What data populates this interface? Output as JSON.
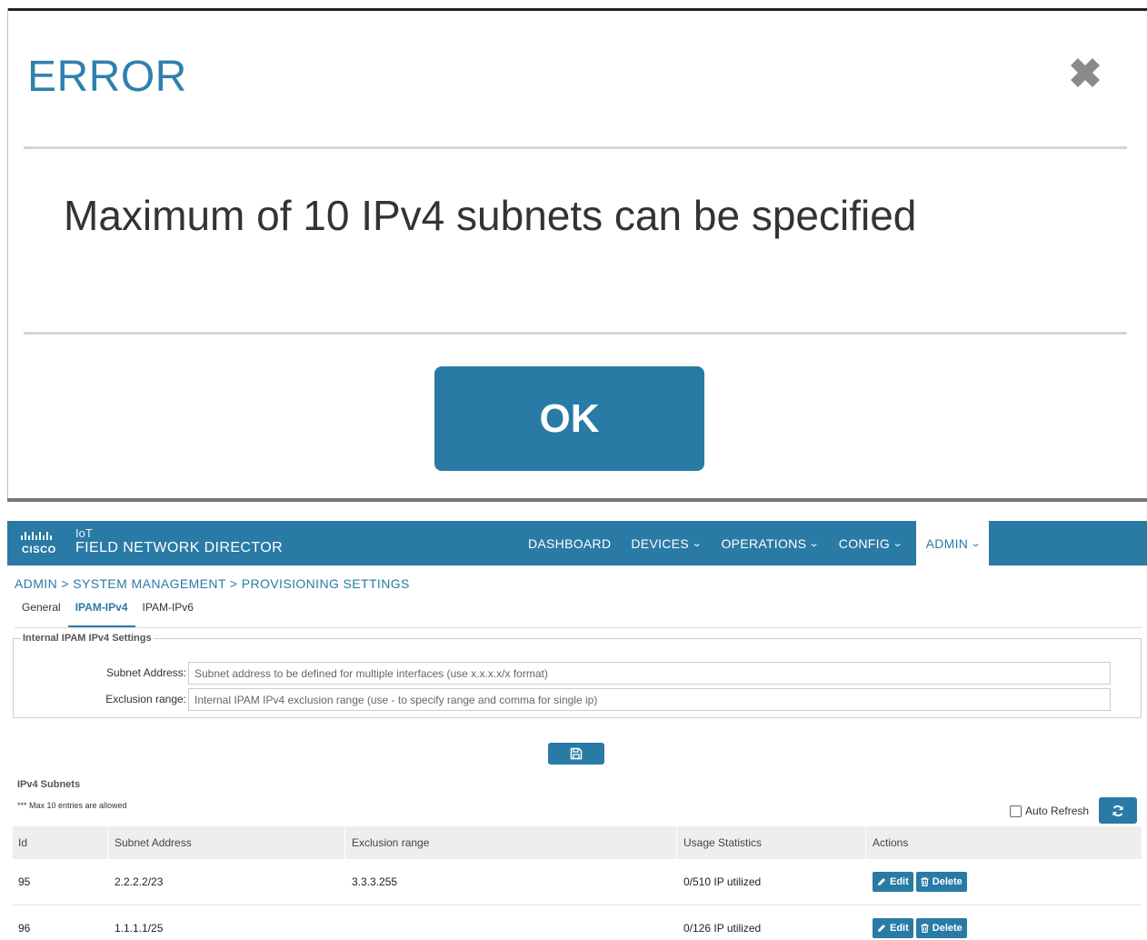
{
  "dialog": {
    "title": "ERROR",
    "message": "Maximum of 10 IPv4 subnets can be specified",
    "ok_label": "OK"
  },
  "header": {
    "brand_word": "CISCO",
    "product_line1": "IoT",
    "product_line2": "FIELD NETWORK DIRECTOR",
    "nav": [
      {
        "label": "DASHBOARD",
        "has_dropdown": false
      },
      {
        "label": "DEVICES",
        "has_dropdown": true
      },
      {
        "label": "OPERATIONS",
        "has_dropdown": true
      },
      {
        "label": "CONFIG",
        "has_dropdown": true
      },
      {
        "label": "ADMIN",
        "has_dropdown": true,
        "active": true
      }
    ]
  },
  "breadcrumb": "ADMIN > SYSTEM MANAGEMENT > PROVISIONING SETTINGS",
  "tabs": [
    {
      "label": "General"
    },
    {
      "label": "IPAM-IPv4",
      "active": true
    },
    {
      "label": "IPAM-IPv6"
    }
  ],
  "settings": {
    "legend": "Internal IPAM IPv4 Settings",
    "subnet_label": "Subnet Address:",
    "subnet_placeholder": "Subnet address to be defined for multiple interfaces (use x.x.x.x/x format)",
    "exclusion_label": "Exclusion range:",
    "exclusion_placeholder": "Internal IPAM IPv4 exclusion range (use - to specify range and comma for single ip)",
    "save_icon": "floppy-disk-icon"
  },
  "subnets": {
    "title": "IPv4 Subnets",
    "note": "*** Max 10 entries are allowed",
    "auto_refresh_label": "Auto Refresh",
    "refresh_icon": "refresh-icon",
    "columns": [
      "Id",
      "Subnet Address",
      "Exclusion range",
      "Usage Statistics",
      "Actions"
    ],
    "rows": [
      {
        "id": "95",
        "subnet": "2.2.2.2/23",
        "exclusion": "3.3.3.255",
        "usage": "0/510 IP utilized"
      },
      {
        "id": "96",
        "subnet": "1.1.1.1/25",
        "exclusion": "",
        "usage": "0/126 IP utilized"
      }
    ],
    "edit_label": "Edit",
    "delete_label": "Delete"
  },
  "colors": {
    "primary": "#2a7aa6",
    "title_blue": "#2f81ad"
  }
}
